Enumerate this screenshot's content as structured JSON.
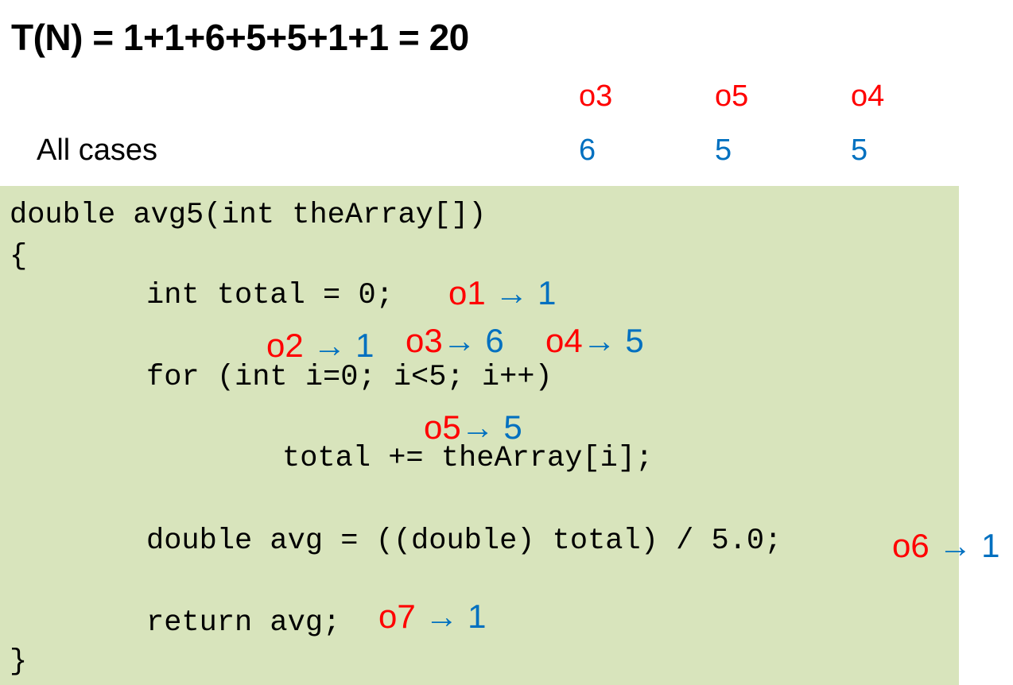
{
  "title": "T(N) = 1+1+6+5+5+1+1 = 20",
  "cases": {
    "label": "All cases",
    "columns": [
      {
        "op": "o3",
        "value": "6"
      },
      {
        "op": "o5",
        "value": "5"
      },
      {
        "op": "o4",
        "value": "5"
      }
    ]
  },
  "code": {
    "lines": [
      "double avg5(int theArray[])",
      "{",
      "int total = 0;",
      "for (int i=0; i<5; i++)",
      "total += theArray[i];",
      "double avg = ((double) total) / 5.0;",
      "return avg;",
      "}"
    ]
  },
  "annotations": [
    {
      "op": "o1",
      "arrow": "→",
      "count": "1"
    },
    {
      "op": "o2",
      "arrow": "→",
      "count": "1"
    },
    {
      "op": "o3",
      "arrow": "→",
      "count": "6"
    },
    {
      "op": "o4",
      "arrow": "→",
      "count": "5"
    },
    {
      "op": "o5",
      "arrow": "→",
      "count": "5"
    },
    {
      "op": "o6",
      "arrow": "→",
      "count": "1"
    },
    {
      "op": "o7",
      "arrow": "→",
      "count": "1"
    }
  ],
  "colors": {
    "op": "#ff0000",
    "count": "#0070c0",
    "code_bg": "#d8e4bc"
  }
}
